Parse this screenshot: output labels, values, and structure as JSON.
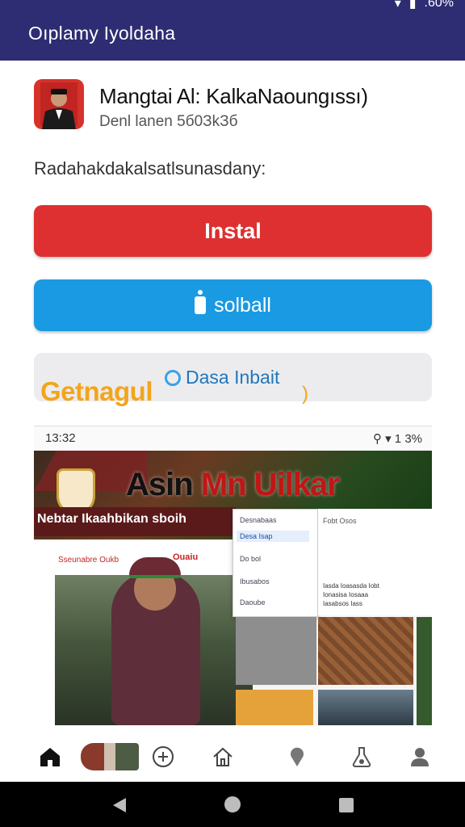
{
  "status": {
    "battery": ".60%"
  },
  "header": {
    "title": "Oıplamy Iyoldaha"
  },
  "listing": {
    "app_name": "Mangtai Al: KalkaNaoungıssı)",
    "subtitle": "Denl lanen 5б0ЗkЗб",
    "description": "Radahakdakalsatlsunasdany:"
  },
  "buttons": {
    "install_label": "Instal",
    "secondary_label": "solball"
  },
  "promo": {
    "orange_text": "Getnagul",
    "blue_text": "Dasa Inbait",
    "paren": ")"
  },
  "preview": {
    "time": "13:32",
    "signal": "⚲ ▾ 1 3%",
    "hero_title_a": "Asin",
    "hero_title_b": "Mn Uilkar",
    "hero_subtitle": "Nebtar Ikaahbikan sboih",
    "left_red_1": "Sseunabre Oukb",
    "left_red_2": "Ouaiu",
    "dropdown": [
      "Desnabaas",
      "Desa Isap",
      "Do bol",
      "Ibusabos",
      "Daoube"
    ],
    "right_title": "Fobt Osos",
    "right_lines": [
      "Iasda Ioasasda Iobt",
      "Ionasisa Iosaaa",
      "Iasabsos Iass"
    ]
  },
  "tabs": [
    "home-icon",
    "profile-thumb",
    "add-icon",
    "house-outline-icon",
    "pin-icon",
    "flask-icon",
    "person-icon"
  ],
  "colors": {
    "appbar": "#2e2c72",
    "install": "#de3030",
    "secondary": "#1a9ae2",
    "promo_orange": "#f3a51a"
  }
}
